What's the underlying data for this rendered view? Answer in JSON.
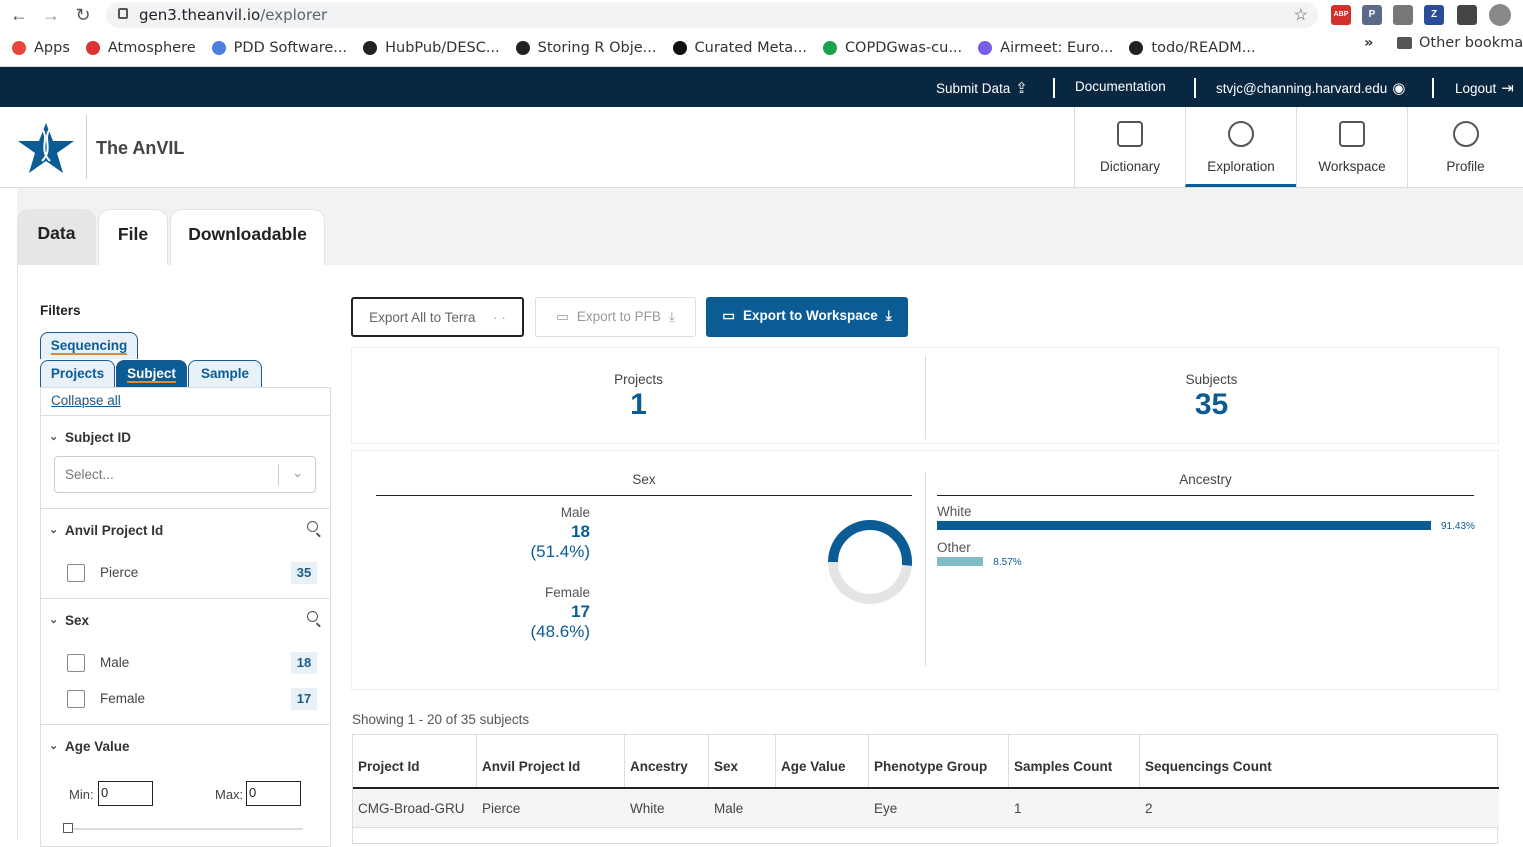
{
  "browser": {
    "url_host": "gen3.theanvil.io",
    "url_path": "/explorer",
    "extensions": [
      {
        "name": "adblock-icon",
        "label": "ABP",
        "color": "#d0312d"
      },
      {
        "name": "p-extension-icon",
        "label": "P",
        "color": "#5b6a8a"
      },
      {
        "name": "circle-extension-icon",
        "label": "",
        "color": "#777777"
      },
      {
        "name": "zotero-icon",
        "label": "Z",
        "color": "#2b4c99"
      },
      {
        "name": "puzzle-icon",
        "label": "",
        "color": "#444444"
      }
    ],
    "bookmarks": [
      {
        "name": "bookmark-apps",
        "label": "Apps",
        "color": "#e8453c"
      },
      {
        "name": "bookmark-atmosphere",
        "label": "Atmosphere",
        "color": "#d33"
      },
      {
        "name": "bookmark-pdd",
        "label": "PDD Software...",
        "color": "#4a7fe0"
      },
      {
        "name": "bookmark-hubpub",
        "label": "HubPub/DESC...",
        "color": "#222"
      },
      {
        "name": "bookmark-storing-r",
        "label": "Storing R Obje...",
        "color": "#222"
      },
      {
        "name": "bookmark-curated-meta",
        "label": "Curated Meta...",
        "color": "#111"
      },
      {
        "name": "bookmark-copdgwas",
        "label": "COPDGwas-cu...",
        "color": "#1aa34a"
      },
      {
        "name": "bookmark-airmeet",
        "label": "Airmeet: Euro...",
        "color": "#7b5ce6"
      },
      {
        "name": "bookmark-todo",
        "label": "todo/READM...",
        "color": "#222"
      }
    ],
    "more": "»",
    "other_bookmarks": "Other bookmar"
  },
  "topbar": {
    "submit_data": "Submit Data",
    "documentation": "Documentation",
    "email": "stvjc@channing.harvard.edu",
    "logout": "Logout"
  },
  "header": {
    "brand": "The AnVIL",
    "nav": [
      {
        "label": "Dictionary",
        "icon": "dictionary-icon"
      },
      {
        "label": "Exploration",
        "icon": "exploration-icon"
      },
      {
        "label": "Workspace",
        "icon": "workspace-icon"
      },
      {
        "label": "Profile",
        "icon": "profile-icon"
      }
    ]
  },
  "data_tabs": [
    "Data",
    "File",
    "Downloadable"
  ],
  "filters": {
    "title": "Filters",
    "top_tab": "Sequencing",
    "tabs": [
      "Projects",
      "Subject",
      "Sample"
    ],
    "collapse_all": "Collapse all",
    "subject_id": {
      "title": "Subject ID",
      "placeholder": "Select..."
    },
    "anvil_project": {
      "title": "Anvil Project Id",
      "options": [
        {
          "label": "Pierce",
          "count": "35"
        }
      ]
    },
    "sex": {
      "title": "Sex",
      "options": [
        {
          "label": "Male",
          "count": "18"
        },
        {
          "label": "Female",
          "count": "17"
        }
      ]
    },
    "age": {
      "title": "Age Value",
      "min_label": "Min:",
      "max_label": "Max:",
      "min_value": "0",
      "max_value": "0"
    }
  },
  "actions": {
    "export_terra": "Export All to Terra",
    "export_pfb": "Export to PFB",
    "export_workspace": "Export to Workspace"
  },
  "stats": {
    "projects_label": "Projects",
    "projects_value": "1",
    "subjects_label": "Subjects",
    "subjects_value": "35"
  },
  "sex_chart": {
    "title": "Sex",
    "male_label": "Male",
    "male_count": "18",
    "male_pct": "(51.4%)",
    "female_label": "Female",
    "female_count": "17",
    "female_pct": "(48.6%)",
    "male_fraction": 0.514,
    "colors": {
      "male": "#0b5b95",
      "female": "#e4e4e4"
    }
  },
  "ancestry_chart": {
    "title": "Ancestry",
    "bars": [
      {
        "label": "White",
        "pct_label": "91.43%",
        "value": 91.43,
        "color": "#0b5b95"
      },
      {
        "label": "Other",
        "pct_label": "8.57%",
        "value": 8.57,
        "color": "#7fbcc6"
      }
    ]
  },
  "table": {
    "showing": "Showing 1 - 20 of 35 subjects",
    "columns": [
      "Project Id",
      "Anvil Project Id",
      "Ancestry",
      "Sex",
      "Age Value",
      "Phenotype Group",
      "Samples Count",
      "Sequencings Count"
    ],
    "rows": [
      [
        "CMG-Broad-GRU",
        "Pierce",
        "White",
        "Male",
        "",
        "Eye",
        "1",
        "2"
      ]
    ]
  }
}
